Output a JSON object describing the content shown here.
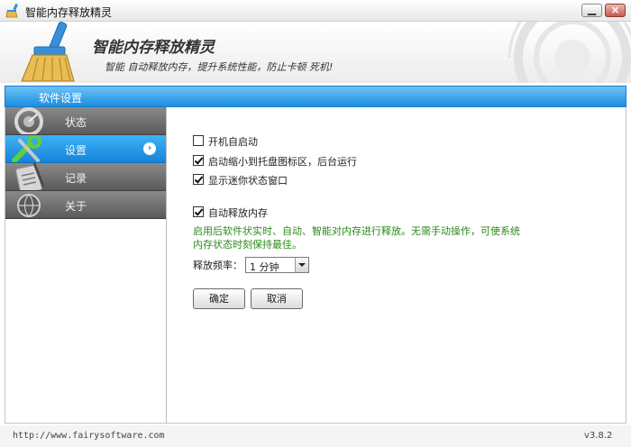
{
  "window": {
    "title": "智能内存释放精灵",
    "minimize_icon": "minimize-icon",
    "close_icon": "close-icon"
  },
  "banner": {
    "title": "智能内存释放精灵",
    "subtitle": "智能 自动释放内存，提升系统性能，防止卡顿 死机!",
    "logo_icon": "broom-icon"
  },
  "section": {
    "title": "软件设置"
  },
  "sidebar": {
    "items": [
      {
        "label": "状态",
        "icon": "dashboard-icon",
        "active": false
      },
      {
        "label": "设置",
        "icon": "tools-icon",
        "active": true
      },
      {
        "label": "记录",
        "icon": "clipboard-icon",
        "active": false
      },
      {
        "label": "关于",
        "icon": "globe-icon",
        "active": false
      }
    ]
  },
  "settings": {
    "autostart": {
      "label": "开机自启动",
      "checked": false
    },
    "minimize_to_tray": {
      "label": "启动缩小到托盘图标区，后台运行",
      "checked": true
    },
    "show_mini_window": {
      "label": "显示迷你状态窗口",
      "checked": true
    },
    "auto_release": {
      "label": "自动释放内存",
      "checked": true
    },
    "hint_line1": "启用后软件状实时、自动、智能对内存进行释放。无需手动操作，可使系统",
    "hint_line2": "内存状态时刻保持最佳。",
    "frequency_label": "释放频率：",
    "frequency_value": "1 分钟",
    "ok_label": "确定",
    "cancel_label": "取消"
  },
  "statusbar": {
    "url": "http://www.fairysoftware.com",
    "version": "v3.8.2"
  },
  "colors": {
    "accent": "#1a8fe2",
    "nav_inactive": "#6e6e6e",
    "hint": "#2a8a1a"
  }
}
